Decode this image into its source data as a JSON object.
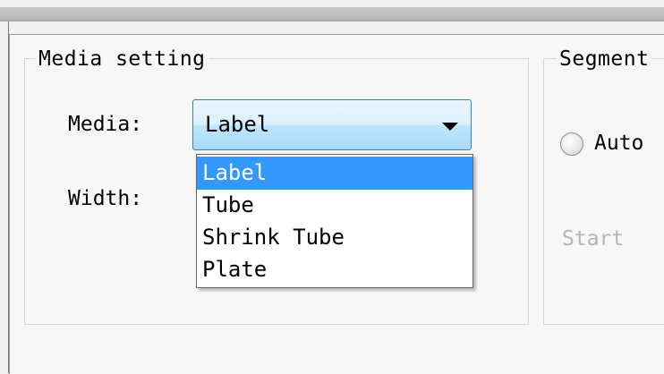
{
  "media_setting": {
    "title": "Media setting",
    "media_label": "Media:",
    "width_label": "Width:",
    "media_combo": {
      "selected": "Label",
      "options": [
        "Label",
        "Tube",
        "Shrink Tube",
        "Plate"
      ]
    }
  },
  "segment": {
    "title": "Segment",
    "radio_auto_label": "Auto",
    "start_label": "Start"
  },
  "colors": {
    "selection": "#3399ff",
    "combo_border": "#3c7fb1",
    "disabled_text": "#b5b5b5"
  }
}
